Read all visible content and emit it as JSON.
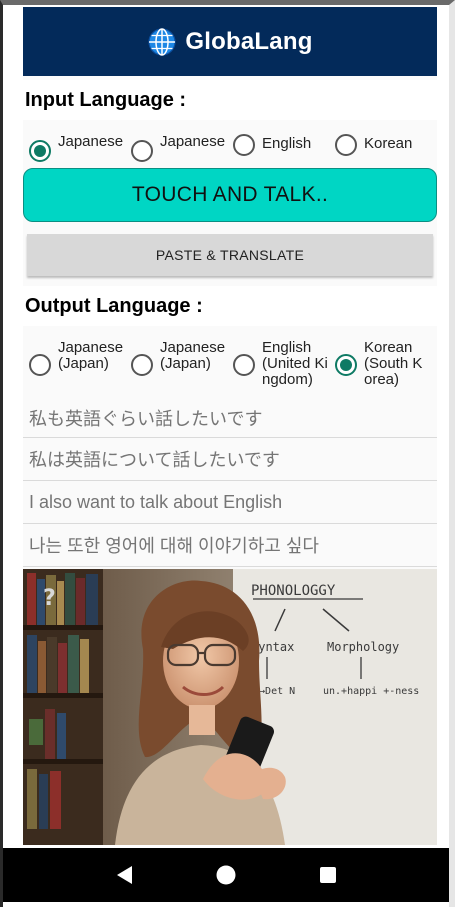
{
  "header": {
    "title": "GlobaLang",
    "icon": "globe-icon"
  },
  "input_section": {
    "label": "Input Language :",
    "options": [
      {
        "label": "Japanese",
        "checked": true
      },
      {
        "label": "Japanese",
        "checked": false
      },
      {
        "label": "English",
        "checked": false
      },
      {
        "label": "Korean",
        "checked": false
      }
    ]
  },
  "buttons": {
    "talk": "TOUCH AND TALK..",
    "paste": "PASTE & TRANSLATE"
  },
  "output_section": {
    "label": "Output Language :",
    "options": [
      {
        "label": "Japanese (Japan)",
        "checked": false
      },
      {
        "label": "Japanese (Japan)",
        "checked": false
      },
      {
        "label": "English (United Kingdom)",
        "checked": false
      },
      {
        "label": "Korean (South Korea)",
        "checked": true
      }
    ]
  },
  "results": [
    "私も英語ぐらい話したいです",
    "私は英語について話したいです",
    "I also want to talk about English",
    "나는 또한 영어에 대해 이야기하고 싶다"
  ],
  "image": {
    "board_title": "PHONOLOGGY",
    "board_left": "Syntax",
    "board_right": "Morphology",
    "board_left_bottom": "NP→Det N",
    "board_right_bottom": "un.+happi +-ness",
    "question_mark": "?"
  },
  "colors": {
    "header": "#032a5a",
    "talk": "#00d6c4",
    "accent": "#0e7a64"
  }
}
